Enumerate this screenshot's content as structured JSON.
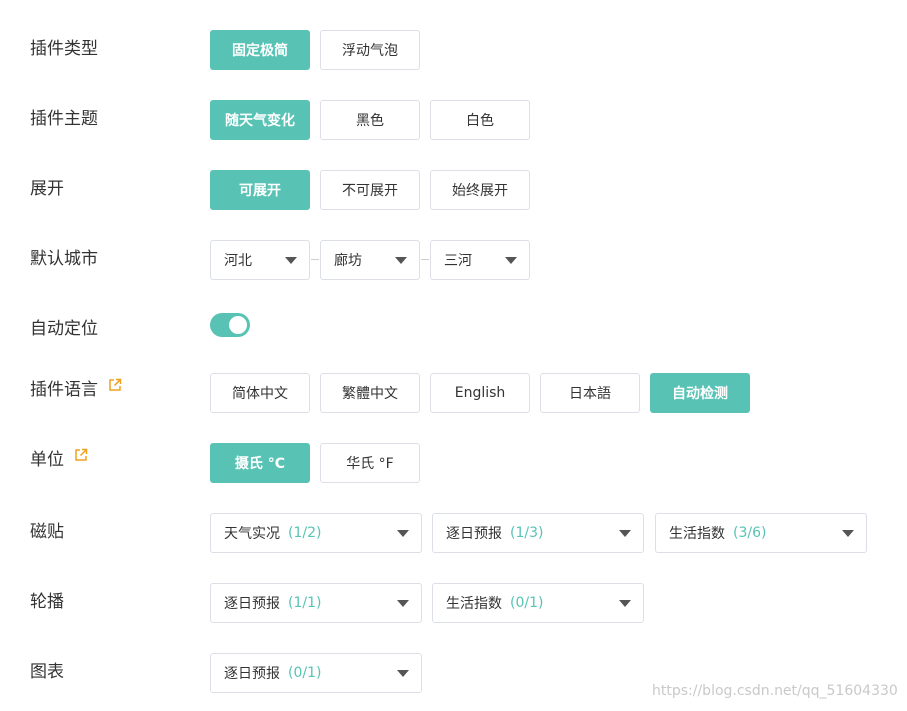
{
  "colors": {
    "accent": "#58c3b4",
    "border": "#dcdfe6",
    "text": "#333333",
    "link_icon": "#f0a020"
  },
  "rows": {
    "plugin_type": {
      "label": "插件类型",
      "options": [
        "固定极简",
        "浮动气泡"
      ],
      "selected": "固定极简"
    },
    "plugin_theme": {
      "label": "插件主题",
      "options": [
        "随天气变化",
        "黑色",
        "白色"
      ],
      "selected": "随天气变化"
    },
    "expand": {
      "label": "展开",
      "options": [
        "可展开",
        "不可展开",
        "始终展开"
      ],
      "selected": "可展开"
    },
    "default_city": {
      "label": "默认城市",
      "province": "河北",
      "city": "廊坊",
      "district": "三河"
    },
    "auto_locate": {
      "label": "自动定位",
      "on": true
    },
    "plugin_language": {
      "label": "插件语言",
      "icon": "external-link-icon",
      "options": [
        "简体中文",
        "繁體中文",
        "English",
        "日本語",
        "自动检测"
      ],
      "selected": "自动检测"
    },
    "unit": {
      "label": "单位",
      "icon": "external-link-icon",
      "options": [
        "摄氏 °C",
        "华氏 °F"
      ],
      "selected": "摄氏 °C"
    },
    "tiles": {
      "label": "磁贴",
      "selects": [
        {
          "text": "天气实况",
          "count": "(1/2)"
        },
        {
          "text": "逐日预报",
          "count": "(1/3)"
        },
        {
          "text": "生活指数",
          "count": "(3/6)"
        }
      ]
    },
    "carousel": {
      "label": "轮播",
      "selects": [
        {
          "text": "逐日预报",
          "count": "(1/1)"
        },
        {
          "text": "生活指数",
          "count": "(0/1)"
        }
      ]
    },
    "chart": {
      "label": "图表",
      "selects": [
        {
          "text": "逐日预报",
          "count": "(0/1)"
        }
      ]
    }
  },
  "watermark": "https://blog.csdn.net/qq_51604330"
}
